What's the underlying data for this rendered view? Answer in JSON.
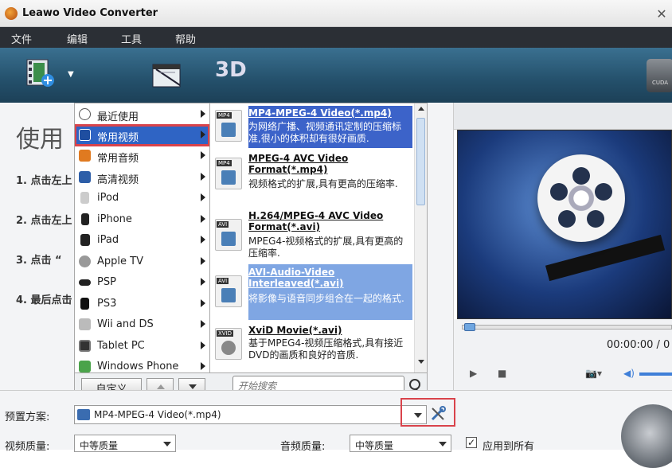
{
  "window": {
    "title": "Leawo Video Converter",
    "close_glyph": "✕"
  },
  "menubar": {
    "items": [
      "文件",
      "编辑",
      "工具",
      "帮助"
    ]
  },
  "toolbar": {
    "label_3d": "3D",
    "cuda_label": "CUDA"
  },
  "guide": {
    "title": "使用",
    "steps": [
      "1. 点击左上",
      "2. 点击左上",
      "3. 点击 “",
      "4. 最后点击"
    ]
  },
  "categories": [
    {
      "label": "最近使用",
      "icon": "clock-icon"
    },
    {
      "label": "常用视频",
      "icon": "film-icon",
      "selected": true
    },
    {
      "label": "常用音频",
      "icon": "music-icon"
    },
    {
      "label": "高清视频",
      "icon": "hd-icon"
    },
    {
      "label": "iPod",
      "icon": "ipod-icon"
    },
    {
      "label": "iPhone",
      "icon": "iphone-icon"
    },
    {
      "label": "iPad",
      "icon": "ipad-icon"
    },
    {
      "label": "Apple TV",
      "icon": "apple-icon"
    },
    {
      "label": "PSP",
      "icon": "psp-icon"
    },
    {
      "label": "PS3",
      "icon": "ps3-icon"
    },
    {
      "label": "Wii and DS",
      "icon": "wii-icon"
    },
    {
      "label": "Tablet PC",
      "icon": "tablet-icon"
    },
    {
      "label": "Windows Phone",
      "icon": "phone-icon"
    }
  ],
  "formats": [
    {
      "tag": "MP4",
      "name": "MP4-MPEG-4 Video(*.mp4)",
      "desc": "为网络广播、视频通讯定制的压缩标准,很小的体积却有很好画质."
    },
    {
      "tag": "MP4",
      "name": "MPEG-4 AVC Video Format(*.mp4)",
      "desc": "视频格式的扩展,具有更高的压缩率."
    },
    {
      "tag": "AVI",
      "name": "H.264/MPEG-4 AVC Video Format(*.avi)",
      "desc": "MPEG4-视频格式的扩展,具有更高的压缩率."
    },
    {
      "tag": "AVI",
      "name": "AVI-Audio-Video Interleaved(*.avi)",
      "desc": "将影像与语音同步组合在一起的格式."
    },
    {
      "tag": "XVID",
      "name": "XviD Movie(*.avi)",
      "desc": "基于MPEG4-视频压缩格式,具有接近DVD的画质和良好的音质."
    }
  ],
  "popup_bottom": {
    "custom_label": "自定义",
    "search_placeholder": "开始搜索"
  },
  "preview": {
    "time": "00:00:00 / 0"
  },
  "settings": {
    "preset_label": "预置方案:",
    "preset_value": "MP4-MPEG-4 Video(*.mp4)",
    "video_quality_label": "视频质量:",
    "video_quality_value": "中等质量",
    "audio_quality_label": "音频质量:",
    "audio_quality_value": "中等质量",
    "apply_all_label": "应用到所有",
    "apply_all_checked": true
  }
}
